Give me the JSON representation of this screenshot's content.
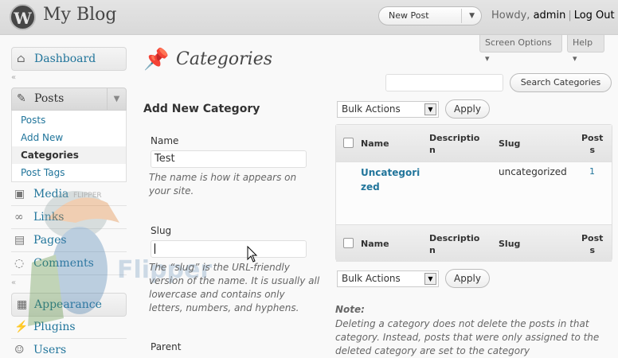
{
  "header": {
    "logo_letter": "W",
    "site_title": "My Blog",
    "new_post_label": "New Post",
    "howdy_prefix": "Howdy, ",
    "username": "admin",
    "separator": "|",
    "logout_label": "Log Out"
  },
  "screen_options": {
    "screen_options_label": "Screen Options ▾",
    "help_label": "Help ▾"
  },
  "sidebar": {
    "dashboard": "Dashboard",
    "posts": "Posts",
    "posts_sub": [
      "Posts",
      "Add New",
      "Categories",
      "Post Tags"
    ],
    "media": "Media",
    "links": "Links",
    "pages": "Pages",
    "comments": "Comments",
    "appearance": "Appearance",
    "plugins": "Plugins",
    "users": "Users",
    "collapse_mark": "«"
  },
  "page": {
    "title": "Categories",
    "search_button": "Search Categories",
    "search_value": ""
  },
  "add_form": {
    "heading": "Add New Category",
    "name_label": "Name",
    "name_value": "Test",
    "name_help": "The name is how it appears on your site.",
    "slug_label": "Slug",
    "slug_value": "",
    "slug_help": "The “slug” is the URL-friendly version of the name. It is usually all lowercase and contains only letters, numbers, and hyphens.",
    "parent_label": "Parent"
  },
  "bulk": {
    "action_label": "Bulk Actions",
    "apply_label": "Apply"
  },
  "table": {
    "col_name": "Name",
    "col_description": "Descriptio\nn",
    "col_slug": "Slug",
    "col_posts": "Post\ns",
    "rows": [
      {
        "name": "Uncategori\nzed",
        "description": "",
        "slug": "uncategorized",
        "count": "1"
      }
    ]
  },
  "note": {
    "title": "Note:",
    "text": "Deleting a category does not delete the posts in that category. Instead, posts that were only assigned to the deleted category are set to the category"
  },
  "watermark": {
    "text": "Flipper",
    "logo_text": "FLIPPER"
  },
  "colors": {
    "link": "#21759b",
    "header_bg": "#e4e4e4",
    "text": "#333333"
  }
}
